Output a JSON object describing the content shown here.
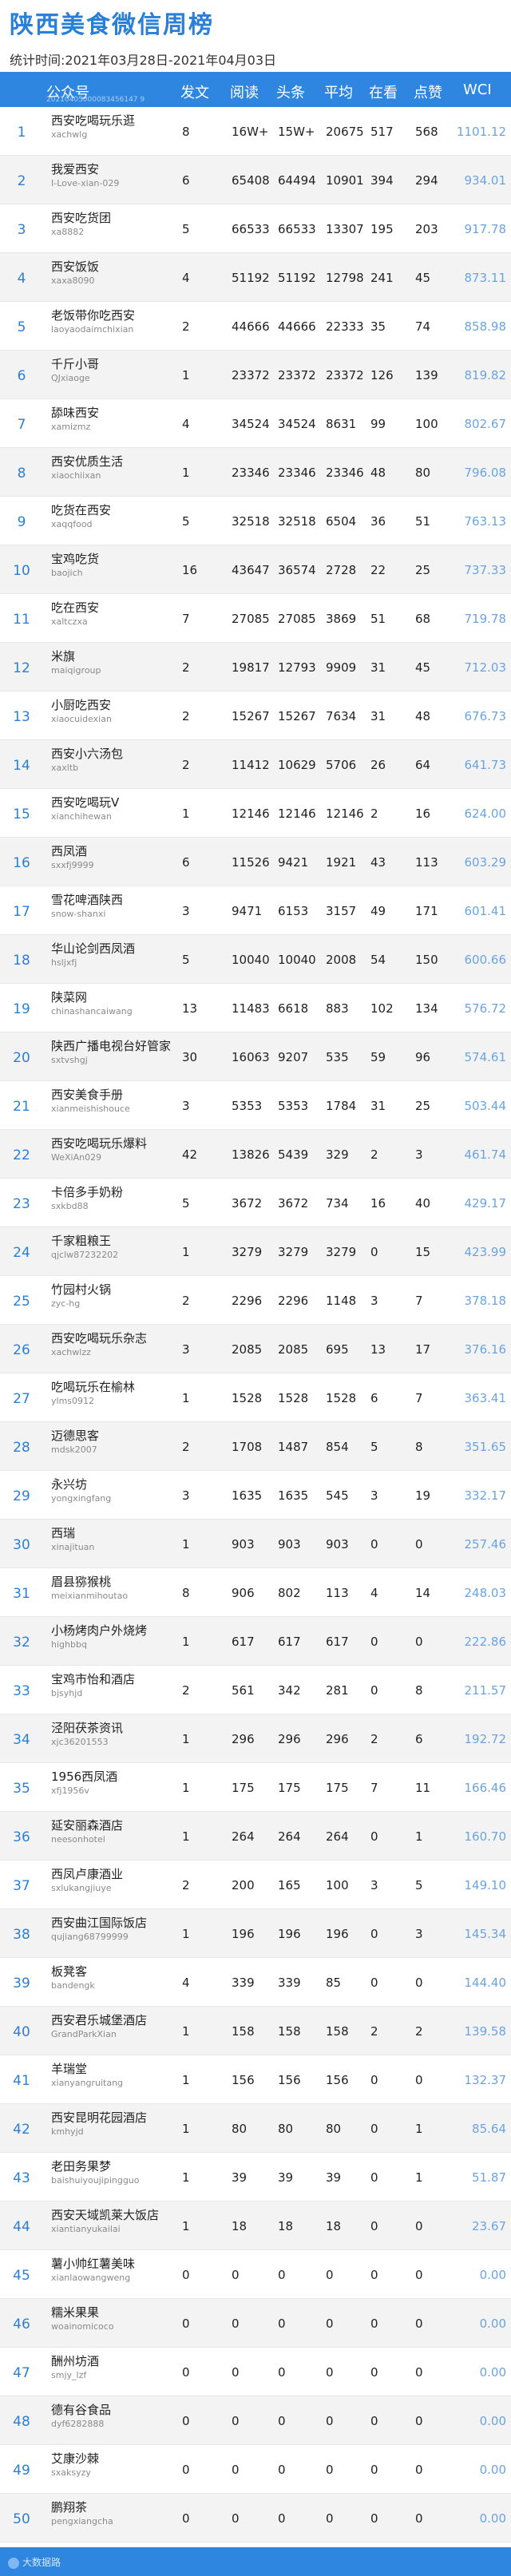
{
  "header": {
    "title": "陕西美食微信周榜",
    "subtitle": "统计时间:2021年03月28日-2021年04月03日"
  },
  "table": {
    "columns": [
      "公众号",
      "发文",
      "阅读",
      "头条",
      "平均",
      "在看",
      "点赞",
      "WCI"
    ],
    "header_sub": "20210405000083456147 9",
    "rows": [
      {
        "rank": "1",
        "name": "西安吃喝玩乐逛",
        "account": "xachwlg",
        "posts": "8",
        "reads": "16W+",
        "head": "15W+",
        "avg": "20675",
        "watch": "517",
        "likes": "568",
        "wci": "1101.12"
      },
      {
        "rank": "2",
        "name": "我爱西安",
        "account": "I-Love-xian-029",
        "posts": "6",
        "reads": "65408",
        "head": "64494",
        "avg": "10901",
        "watch": "394",
        "likes": "294",
        "wci": "934.01"
      },
      {
        "rank": "3",
        "name": "西安吃货团",
        "account": "xa8882",
        "posts": "5",
        "reads": "66533",
        "head": "66533",
        "avg": "13307",
        "watch": "195",
        "likes": "203",
        "wci": "917.78"
      },
      {
        "rank": "4",
        "name": "西安饭饭",
        "account": "xaxa8090",
        "posts": "4",
        "reads": "51192",
        "head": "51192",
        "avg": "12798",
        "watch": "241",
        "likes": "45",
        "wci": "873.11"
      },
      {
        "rank": "5",
        "name": "老饭带你吃西安",
        "account": "laoyaodaimchixian",
        "posts": "2",
        "reads": "44666",
        "head": "44666",
        "avg": "22333",
        "watch": "35",
        "likes": "74",
        "wci": "858.98"
      },
      {
        "rank": "6",
        "name": "千斤小哥",
        "account": "QJxiaoge",
        "posts": "1",
        "reads": "23372",
        "head": "23372",
        "avg": "23372",
        "watch": "126",
        "likes": "139",
        "wci": "819.82"
      },
      {
        "rank": "7",
        "name": "舔味西安",
        "account": "xamizmz",
        "posts": "4",
        "reads": "34524",
        "head": "34524",
        "avg": "8631",
        "watch": "99",
        "likes": "100",
        "wci": "802.67"
      },
      {
        "rank": "8",
        "name": "西安优质生活",
        "account": "xiaochiixan",
        "posts": "1",
        "reads": "23346",
        "head": "23346",
        "avg": "23346",
        "watch": "48",
        "likes": "80",
        "wci": "796.08"
      },
      {
        "rank": "9",
        "name": "吃货在西安",
        "account": "xaqqfood",
        "posts": "5",
        "reads": "32518",
        "head": "32518",
        "avg": "6504",
        "watch": "36",
        "likes": "51",
        "wci": "763.13"
      },
      {
        "rank": "10",
        "name": "宝鸡吃货",
        "account": "baojich",
        "posts": "16",
        "reads": "43647",
        "head": "36574",
        "avg": "2728",
        "watch": "22",
        "likes": "25",
        "wci": "737.33"
      },
      {
        "rank": "11",
        "name": "吃在西安",
        "account": "xaltczxa",
        "posts": "7",
        "reads": "27085",
        "head": "27085",
        "avg": "3869",
        "watch": "51",
        "likes": "68",
        "wci": "719.78"
      },
      {
        "rank": "12",
        "name": "米旗",
        "account": "maiqigroup",
        "posts": "2",
        "reads": "19817",
        "head": "12793",
        "avg": "9909",
        "watch": "31",
        "likes": "45",
        "wci": "712.03"
      },
      {
        "rank": "13",
        "name": "小厨吃西安",
        "account": "xiaocuidexian",
        "posts": "2",
        "reads": "15267",
        "head": "15267",
        "avg": "7634",
        "watch": "31",
        "likes": "48",
        "wci": "676.73"
      },
      {
        "rank": "14",
        "name": "西安小六汤包",
        "account": "xaxltb",
        "posts": "2",
        "reads": "11412",
        "head": "10629",
        "avg": "5706",
        "watch": "26",
        "likes": "64",
        "wci": "641.73"
      },
      {
        "rank": "15",
        "name": "西安吃喝玩V",
        "account": "xianchihewan",
        "posts": "1",
        "reads": "12146",
        "head": "12146",
        "avg": "12146",
        "watch": "2",
        "likes": "16",
        "wci": "624.00"
      },
      {
        "rank": "16",
        "name": "西凤酒",
        "account": "sxxfj9999",
        "posts": "6",
        "reads": "11526",
        "head": "9421",
        "avg": "1921",
        "watch": "43",
        "likes": "113",
        "wci": "603.29"
      },
      {
        "rank": "17",
        "name": "雪花啤酒陕西",
        "account": "snow-shanxi",
        "posts": "3",
        "reads": "9471",
        "head": "6153",
        "avg": "3157",
        "watch": "49",
        "likes": "171",
        "wci": "601.41"
      },
      {
        "rank": "18",
        "name": "华山论剑西凤酒",
        "account": "hsljxfj",
        "posts": "5",
        "reads": "10040",
        "head": "10040",
        "avg": "2008",
        "watch": "54",
        "likes": "150",
        "wci": "600.66"
      },
      {
        "rank": "19",
        "name": "陕菜网",
        "account": "chinashancaiwang",
        "posts": "13",
        "reads": "11483",
        "head": "6618",
        "avg": "883",
        "watch": "102",
        "likes": "134",
        "wci": "576.72"
      },
      {
        "rank": "20",
        "name": "陕西广播电视台好管家",
        "account": "sxtvshgj",
        "posts": "30",
        "reads": "16063",
        "head": "9207",
        "avg": "535",
        "watch": "59",
        "likes": "96",
        "wci": "574.61"
      },
      {
        "rank": "21",
        "name": "西安美食手册",
        "account": "xianmeishishouce",
        "posts": "3",
        "reads": "5353",
        "head": "5353",
        "avg": "1784",
        "watch": "31",
        "likes": "25",
        "wci": "503.44"
      },
      {
        "rank": "22",
        "name": "西安吃喝玩乐爆料",
        "account": "WeXiAn029",
        "posts": "42",
        "reads": "13826",
        "head": "5439",
        "avg": "329",
        "watch": "2",
        "likes": "3",
        "wci": "461.74"
      },
      {
        "rank": "23",
        "name": "卡倍多手奶粉",
        "account": "sxkbd88",
        "posts": "5",
        "reads": "3672",
        "head": "3672",
        "avg": "734",
        "watch": "16",
        "likes": "40",
        "wci": "429.17"
      },
      {
        "rank": "24",
        "name": "千家粗粮王",
        "account": "qjclw87232202",
        "posts": "1",
        "reads": "3279",
        "head": "3279",
        "avg": "3279",
        "watch": "0",
        "likes": "15",
        "wci": "423.99"
      },
      {
        "rank": "25",
        "name": "竹园村火锅",
        "account": "zyc-hg",
        "posts": "2",
        "reads": "2296",
        "head": "2296",
        "avg": "1148",
        "watch": "3",
        "likes": "7",
        "wci": "378.18"
      },
      {
        "rank": "26",
        "name": "西安吃喝玩乐杂志",
        "account": "xachwlzz",
        "posts": "3",
        "reads": "2085",
        "head": "2085",
        "avg": "695",
        "watch": "13",
        "likes": "17",
        "wci": "376.16"
      },
      {
        "rank": "27",
        "name": "吃喝玩乐在榆林",
        "account": "ylms0912",
        "posts": "1",
        "reads": "1528",
        "head": "1528",
        "avg": "1528",
        "watch": "6",
        "likes": "7",
        "wci": "363.41"
      },
      {
        "rank": "28",
        "name": "迈德思客",
        "account": "mdsk2007",
        "posts": "2",
        "reads": "1708",
        "head": "1487",
        "avg": "854",
        "watch": "5",
        "likes": "8",
        "wci": "351.65"
      },
      {
        "rank": "29",
        "name": "永兴坊",
        "account": "yongxingfang",
        "posts": "3",
        "reads": "1635",
        "head": "1635",
        "avg": "545",
        "watch": "3",
        "likes": "19",
        "wci": "332.17"
      },
      {
        "rank": "30",
        "name": "西瑞",
        "account": "xinajituan",
        "posts": "1",
        "reads": "903",
        "head": "903",
        "avg": "903",
        "watch": "0",
        "likes": "0",
        "wci": "257.46"
      },
      {
        "rank": "31",
        "name": "眉县猕猴桃",
        "account": "meixianmihoutao",
        "posts": "8",
        "reads": "906",
        "head": "802",
        "avg": "113",
        "watch": "4",
        "likes": "14",
        "wci": "248.03"
      },
      {
        "rank": "32",
        "name": "小杨烤肉户外烧烤",
        "account": "highbbq",
        "posts": "1",
        "reads": "617",
        "head": "617",
        "avg": "617",
        "watch": "0",
        "likes": "0",
        "wci": "222.86"
      },
      {
        "rank": "33",
        "name": "宝鸡市怡和酒店",
        "account": "bjsyhjd",
        "posts": "2",
        "reads": "561",
        "head": "342",
        "avg": "281",
        "watch": "0",
        "likes": "8",
        "wci": "211.57"
      },
      {
        "rank": "34",
        "name": "泾阳茯茶资讯",
        "account": "xjc36201553",
        "posts": "1",
        "reads": "296",
        "head": "296",
        "avg": "296",
        "watch": "2",
        "likes": "6",
        "wci": "192.72"
      },
      {
        "rank": "35",
        "name": "1956西凤酒",
        "account": "xfj1956v",
        "posts": "1",
        "reads": "175",
        "head": "175",
        "avg": "175",
        "watch": "7",
        "likes": "11",
        "wci": "166.46"
      },
      {
        "rank": "36",
        "name": "延安丽森酒店",
        "account": "neesonhotel",
        "posts": "1",
        "reads": "264",
        "head": "264",
        "avg": "264",
        "watch": "0",
        "likes": "1",
        "wci": "160.70"
      },
      {
        "rank": "37",
        "name": "西凤卢康酒业",
        "account": "sxlukangjiuye",
        "posts": "2",
        "reads": "200",
        "head": "165",
        "avg": "100",
        "watch": "3",
        "likes": "5",
        "wci": "149.10"
      },
      {
        "rank": "38",
        "name": "西安曲江国际饭店",
        "account": "qujiang68799999",
        "posts": "1",
        "reads": "196",
        "head": "196",
        "avg": "196",
        "watch": "0",
        "likes": "3",
        "wci": "145.34"
      },
      {
        "rank": "39",
        "name": "板凳客",
        "account": "bandengk",
        "posts": "4",
        "reads": "339",
        "head": "339",
        "avg": "85",
        "watch": "0",
        "likes": "0",
        "wci": "144.40"
      },
      {
        "rank": "40",
        "name": "西安君乐城堡酒店",
        "account": "GrandParkXian",
        "posts": "1",
        "reads": "158",
        "head": "158",
        "avg": "158",
        "watch": "2",
        "likes": "2",
        "wci": "139.58"
      },
      {
        "rank": "41",
        "name": "羊瑞堂",
        "account": "xianyangruitang",
        "posts": "1",
        "reads": "156",
        "head": "156",
        "avg": "156",
        "watch": "0",
        "likes": "0",
        "wci": "132.37"
      },
      {
        "rank": "42",
        "name": "西安昆明花园酒店",
        "account": "kmhyjd",
        "posts": "1",
        "reads": "80",
        "head": "80",
        "avg": "80",
        "watch": "0",
        "likes": "1",
        "wci": "85.64"
      },
      {
        "rank": "43",
        "name": "老田务果梦",
        "account": "baishuiyoujipingguo",
        "posts": "1",
        "reads": "39",
        "head": "39",
        "avg": "39",
        "watch": "0",
        "likes": "1",
        "wci": "51.87"
      },
      {
        "rank": "44",
        "name": "西安天域凯莱大饭店",
        "account": "xiantianyukailai",
        "posts": "1",
        "reads": "18",
        "head": "18",
        "avg": "18",
        "watch": "0",
        "likes": "0",
        "wci": "23.67"
      },
      {
        "rank": "45",
        "name": "薯小帅红薯美味",
        "account": "xianlaowangweng",
        "posts": "0",
        "reads": "0",
        "head": "0",
        "avg": "0",
        "watch": "0",
        "likes": "0",
        "wci": "0.00"
      },
      {
        "rank": "46",
        "name": "糯米果果",
        "account": "woainomicoco",
        "posts": "0",
        "reads": "0",
        "head": "0",
        "avg": "0",
        "watch": "0",
        "likes": "0",
        "wci": "0.00"
      },
      {
        "rank": "47",
        "name": "酬州坊酒",
        "account": "smjy_lzf",
        "posts": "0",
        "reads": "0",
        "head": "0",
        "avg": "0",
        "watch": "0",
        "likes": "0",
        "wci": "0.00"
      },
      {
        "rank": "48",
        "name": "德有谷食品",
        "account": "dyf6282888",
        "posts": "0",
        "reads": "0",
        "head": "0",
        "avg": "0",
        "watch": "0",
        "likes": "0",
        "wci": "0.00"
      },
      {
        "rank": "49",
        "name": "艾康沙棘",
        "account": "sxaksyzy",
        "posts": "0",
        "reads": "0",
        "head": "0",
        "avg": "0",
        "watch": "0",
        "likes": "0",
        "wci": "0.00"
      },
      {
        "rank": "50",
        "name": "鹏翔茶",
        "account": "pengxiangcha",
        "posts": "0",
        "reads": "0",
        "head": "0",
        "avg": "0",
        "watch": "0",
        "likes": "0",
        "wci": "0.00"
      }
    ]
  },
  "footer": {
    "logo_text": "大数据路"
  },
  "colors": {
    "accent": "#2f86e0",
    "title": "#2a7fd6",
    "wci": "#6ba4e0"
  }
}
